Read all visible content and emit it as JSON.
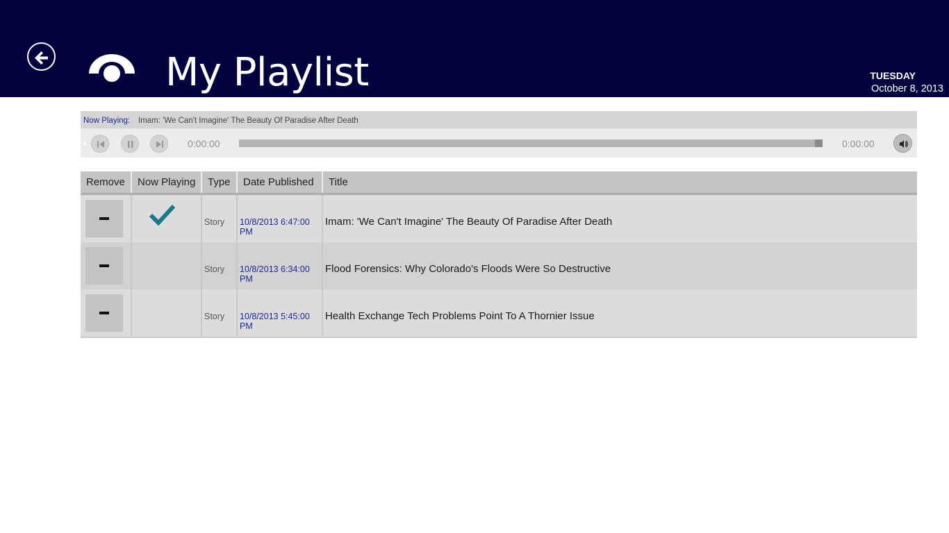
{
  "header": {
    "title": "My Playlist",
    "day": "TUESDAY",
    "date": "October 8, 2013",
    "background": "#02023f"
  },
  "player": {
    "now_playing_label": "Now Playing:",
    "now_playing_title": "Imam: 'We Can't Imagine' The Beauty Of Paradise After Death",
    "current_time": "0:00:00",
    "total_time": "0:00:00",
    "progress": 0,
    "controls": [
      "previous-icon",
      "pause-icon",
      "next-icon",
      "volume-icon"
    ]
  },
  "table": {
    "columns": [
      "Remove",
      "Now Playing",
      "Type",
      "Date Published",
      "Title"
    ],
    "rows": [
      {
        "now_playing": true,
        "type": "Story",
        "date_published": "10/8/2013 6:47:00 PM",
        "title": "Imam: 'We Can't Imagine' The Beauty Of Paradise After Death"
      },
      {
        "now_playing": false,
        "type": "Story",
        "date_published": "10/8/2013 6:34:00 PM",
        "title": "Flood Forensics: Why Colorado's Floods Were So Destructive"
      },
      {
        "now_playing": false,
        "type": "Story",
        "date_published": "10/8/2013 5:45:00 PM",
        "title": "Health Exchange Tech Problems Point To A Thornier Issue"
      }
    ]
  },
  "colors": {
    "accent": "#1a2a9c",
    "check": "#177a8a"
  }
}
